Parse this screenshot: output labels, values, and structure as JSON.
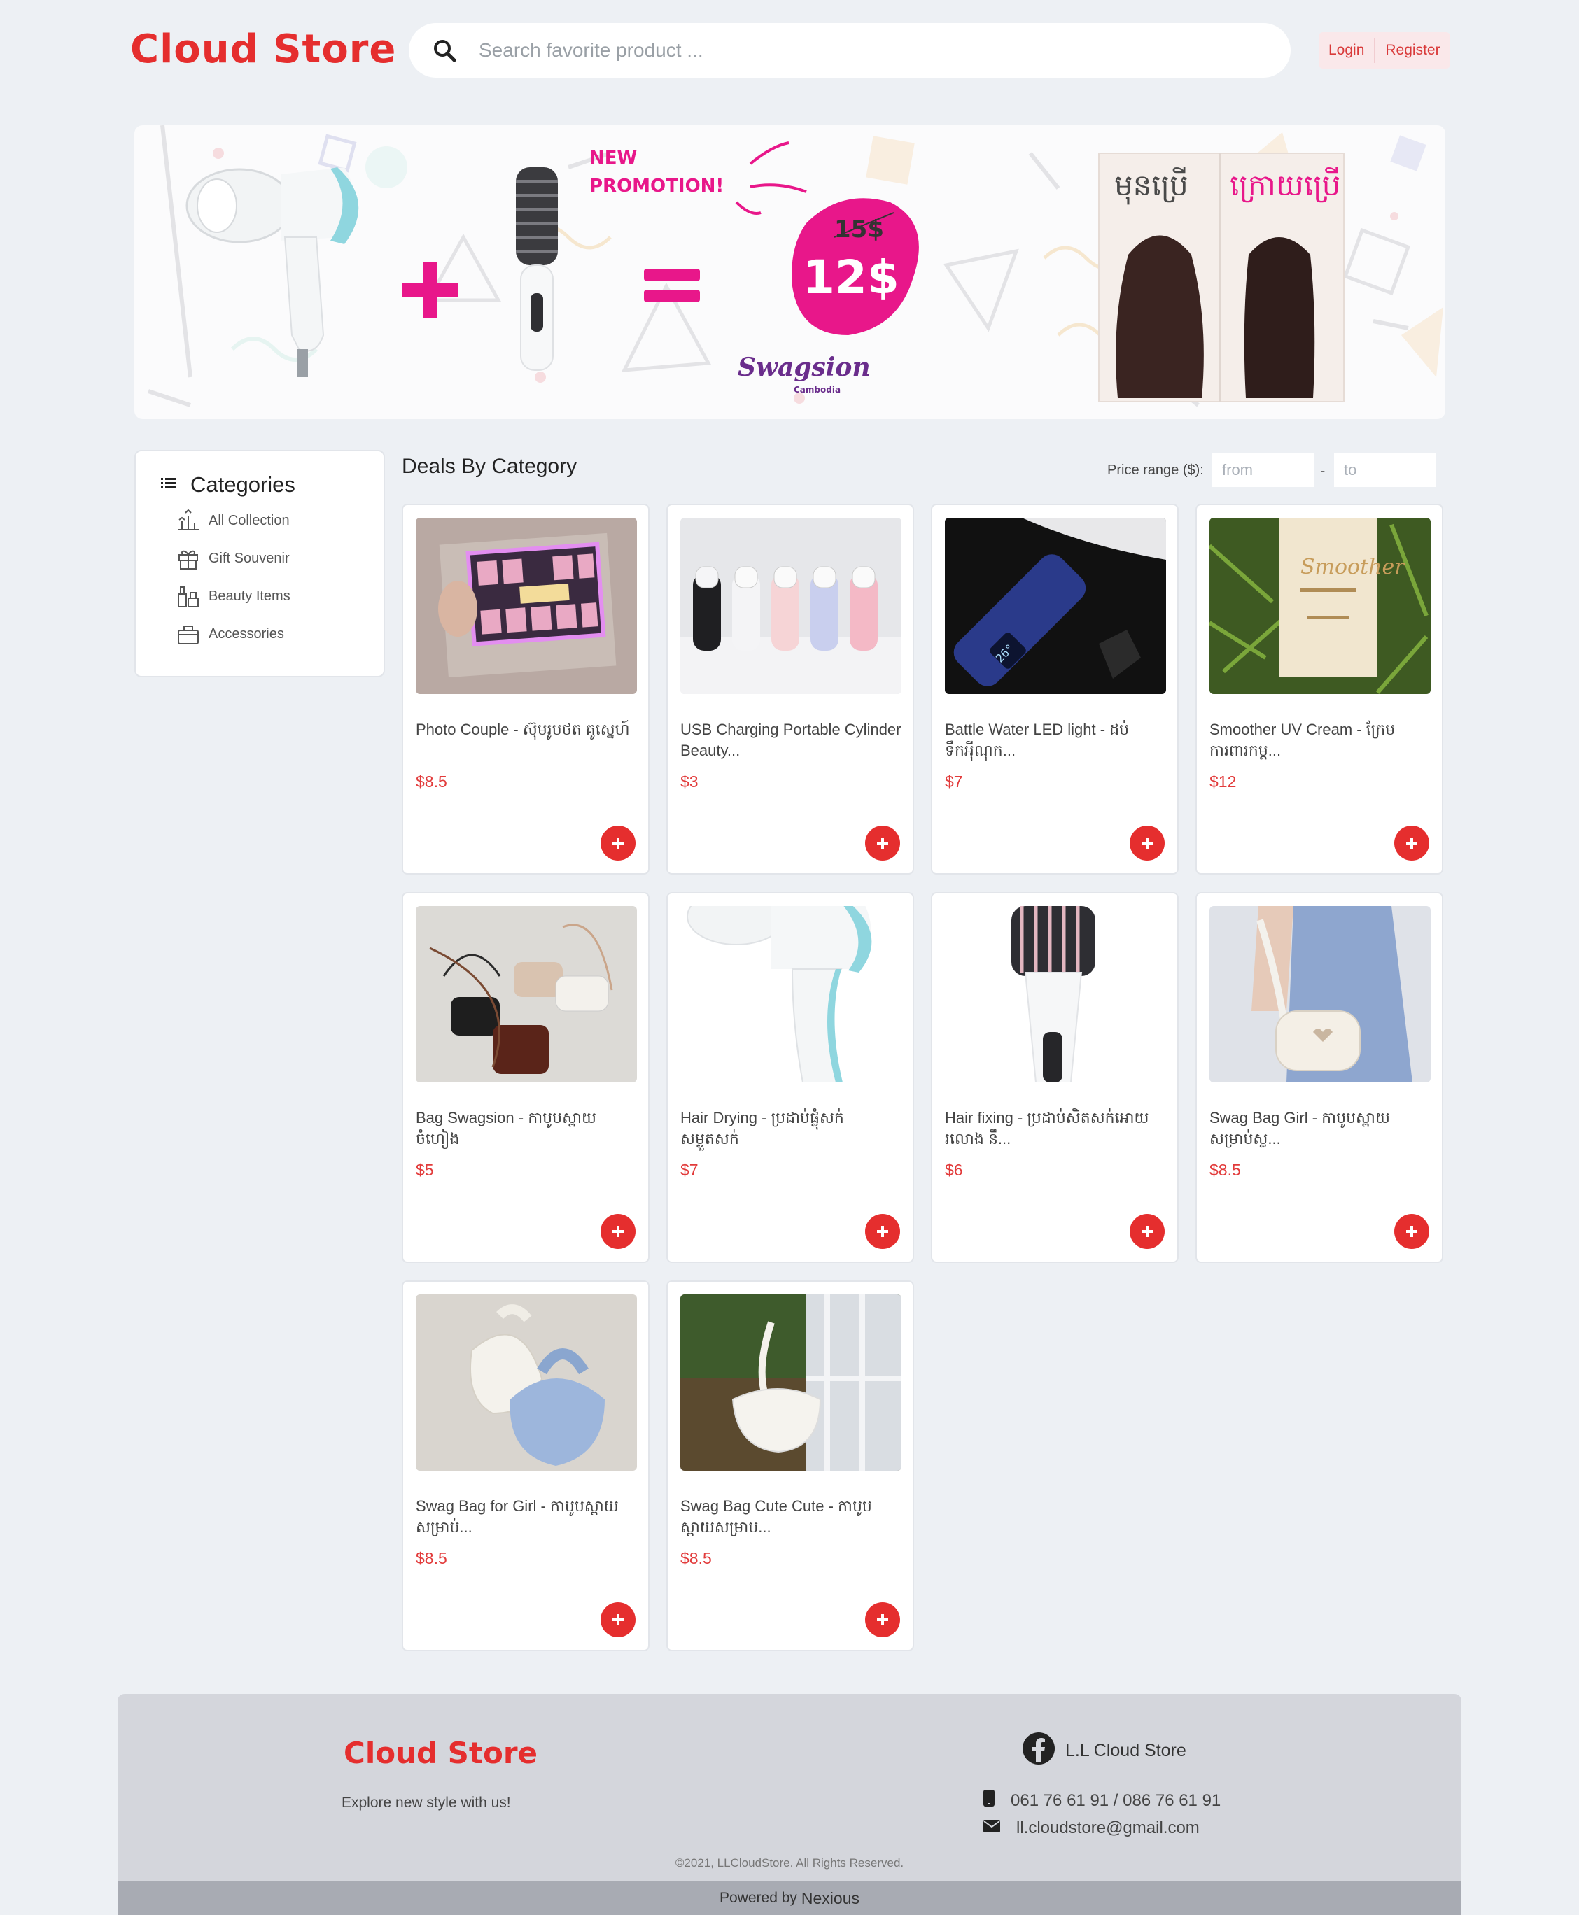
{
  "header": {
    "logo": "Cloud Store",
    "search_placeholder": "Search favorite product ...",
    "login_label": "Login",
    "register_label": "Register"
  },
  "banner": {
    "headline_line1": "NEW",
    "headline_line2": "PROMOTION!",
    "old_price": "15$",
    "new_price": "12$",
    "brand": "Swagsion",
    "brand_sub": "Cambodia",
    "before_label": "មុនប្រើ",
    "after_label": "ក្រោយប្រើ",
    "accent_color": "#e8178a"
  },
  "sidebar": {
    "title": "Categories",
    "items": [
      {
        "label": "All Collection",
        "icon": "collection-icon"
      },
      {
        "label": "Gift Souvenir",
        "icon": "gift-icon"
      },
      {
        "label": "Beauty Items",
        "icon": "beauty-icon"
      },
      {
        "label": "Accessories",
        "icon": "bag-icon"
      }
    ]
  },
  "deals": {
    "title": "Deals By Category",
    "price_range_label": "Price range ($):",
    "from_placeholder": "from",
    "to_placeholder": "to",
    "range_separator": "-"
  },
  "products": [
    {
      "name": "Photo Couple - ស៊ុមរូបថត គូស្នេហ៍",
      "price": "$8.5"
    },
    {
      "name": "USB Charging Portable Cylinder Beauty...",
      "price": "$3"
    },
    {
      "name": "Battle Water LED light - ដប់ ទឹកអុីណុក...",
      "price": "$7"
    },
    {
      "name": "Smoother UV Cream - ក្រែម ការពារកម្ត...",
      "price": "$12"
    },
    {
      "name": "Bag Swagsion - កាបូបស្ពាយ ចំហៀង",
      "price": "$5"
    },
    {
      "name": "Hair Drying - ប្រដាប់ផ្លុំសក់ សម្ងួតសក់",
      "price": "$7"
    },
    {
      "name": "Hair fixing - ប្រដាប់សិតសក់អោយ រលោង នឹ...",
      "price": "$6"
    },
    {
      "name": "Swag Bag Girl - កាបូបស្ពាយ សម្រាប់ស្ល...",
      "price": "$8.5"
    },
    {
      "name": "Swag Bag for Girl - កាបូបស្ពាយ សម្រាប់...",
      "price": "$8.5"
    },
    {
      "name": "Swag Bag Cute Cute - កាបូប ស្ពាយសម្រាប...",
      "price": "$8.5"
    }
  ],
  "footer": {
    "logo": "Cloud Store",
    "tagline": "Explore new style with us!",
    "facebook": "L.L Cloud Store",
    "phone": "061 76 61 91 / 086 76 61 91",
    "email": "ll.cloudstore@gmail.com",
    "copyright": "©2021, LLCloudStore. All Rights Reserved.",
    "powered_prefix": "Powered by",
    "powered_name": "Nexious"
  }
}
